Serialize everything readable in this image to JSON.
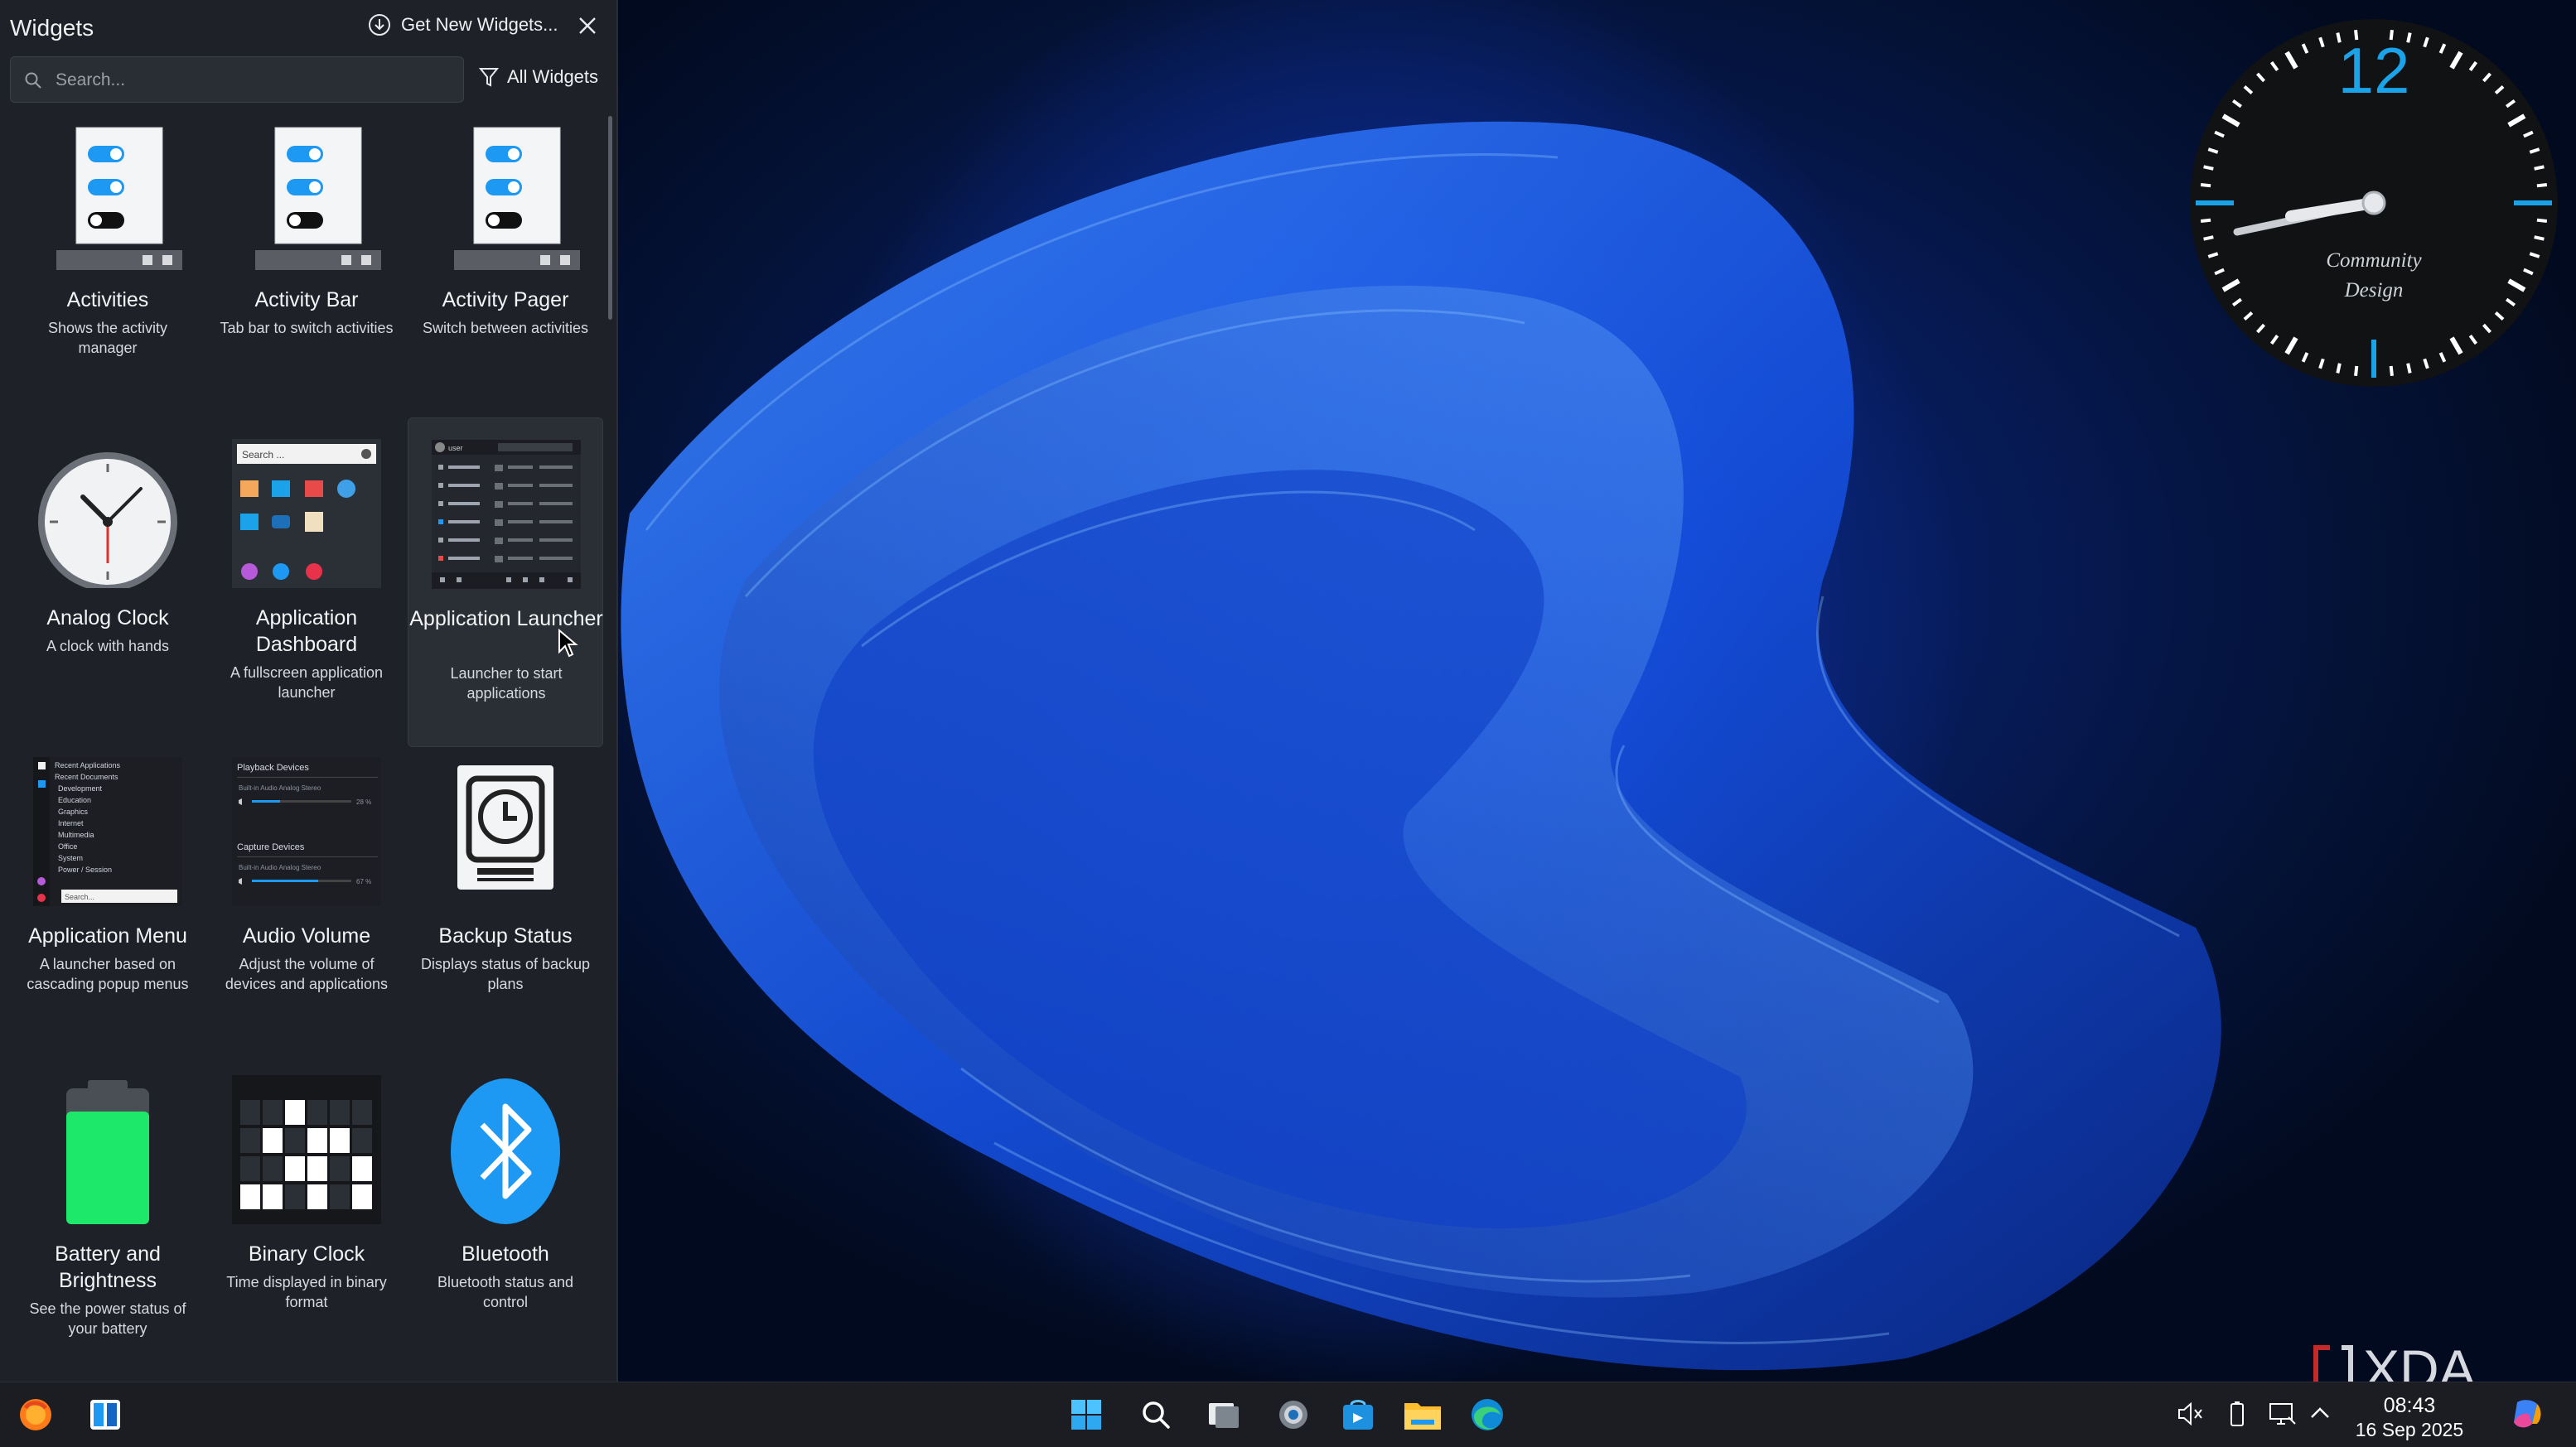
{
  "panel": {
    "title": "Widgets",
    "get_new_label": "Get New Widgets...",
    "search_placeholder": "Search...",
    "filter_label": "All Widgets"
  },
  "widgets": [
    {
      "name": "Activities",
      "desc": "Shows the activity manager",
      "icon": "activities-icon"
    },
    {
      "name": "Activity Bar",
      "desc": "Tab bar to switch activities",
      "icon": "activity-bar-icon"
    },
    {
      "name": "Activity Pager",
      "desc": "Switch between activities",
      "icon": "activity-pager-icon"
    },
    {
      "name": "Analog Clock",
      "desc": "A clock with hands",
      "icon": "analog-clock-icon"
    },
    {
      "name": "Application Dashboard",
      "desc": "A fullscreen application launcher",
      "icon": "application-dashboard-icon"
    },
    {
      "name": "Application Launcher",
      "desc": "Launcher to start applications",
      "icon": "application-launcher-icon"
    },
    {
      "name": "Application Menu",
      "desc": "A launcher based on cascading popup menus",
      "icon": "application-menu-icon"
    },
    {
      "name": "Audio Volume",
      "desc": "Adjust the volume of devices and applications",
      "icon": "audio-volume-icon"
    },
    {
      "name": "Backup Status",
      "desc": "Displays status of backup plans",
      "icon": "backup-status-icon"
    },
    {
      "name": "Battery and Brightness",
      "desc": "See the power status of your battery",
      "icon": "battery-icon"
    },
    {
      "name": "Binary Clock",
      "desc": "Time displayed in binary format",
      "icon": "binary-clock-icon"
    },
    {
      "name": "Bluetooth",
      "desc": "Bluetooth status and control",
      "icon": "bluetooth-icon"
    }
  ],
  "thumb_text": {
    "dashboard_search": "Search ...",
    "launcher_user": "user",
    "menu_items": [
      "Recent Applications",
      "Recent Documents",
      "Development",
      "Education",
      "Graphics",
      "Internet",
      "Multimedia",
      "Office",
      "System",
      "Power / Session"
    ],
    "menu_search": "Search...",
    "audio_playback": "Playback Devices",
    "audio_capture": "Capture Devices",
    "audio_device_1": "Built-in Audio Analog Stereo",
    "audio_pct_1": "28 %",
    "audio_device_2": "Built-in Audio Analog Stereo",
    "audio_pct_2": "67 %"
  },
  "clock_widget": {
    "twelve": "12",
    "brand_line1": "Community",
    "brand_line2": "Design",
    "accent": "#1aa3e8"
  },
  "taskbar": {
    "left_icons": [
      "firefox-icon",
      "widgets-icon"
    ],
    "center_icons": [
      "start-icon",
      "search-icon",
      "task-view-icon",
      "settings-icon",
      "store-icon",
      "file-explorer-icon",
      "edge-icon"
    ],
    "tray_icons": [
      "mute-icon",
      "battery-icon",
      "network-icon",
      "chevron-up-icon"
    ],
    "time": "08:43",
    "date": "16 Sep 2025",
    "copilot_icon": "copilot-icon"
  },
  "watermark": "XDA",
  "colors": {
    "panel_bg": "#1e2127",
    "taskbar_bg": "#1b1d22",
    "accent_blue": "#1aa3e8",
    "toggle_blue": "#1d99f3",
    "battery_green": "#1ee86a"
  }
}
